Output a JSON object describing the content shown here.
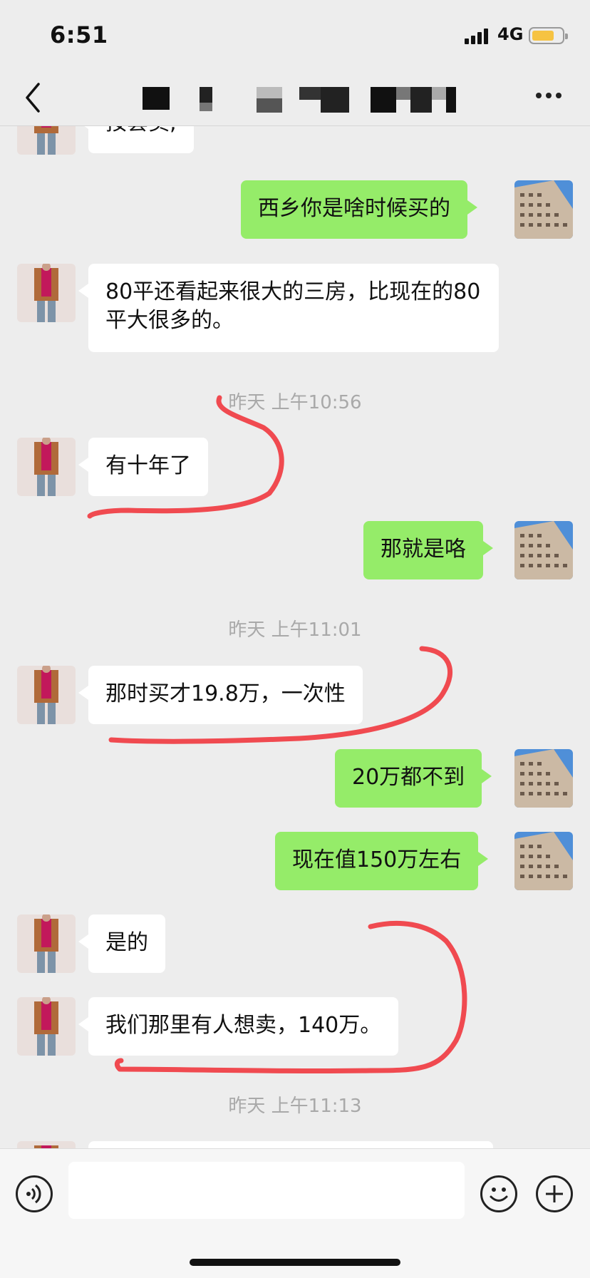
{
  "status_bar": {
    "time": "6:51",
    "network": "4G",
    "battery_level": 0.7,
    "battery_color": "#f6c342"
  },
  "nav": {
    "back_icon": "chevron-left-icon",
    "title": "",
    "title_obscured": true,
    "more_icon": "more-dots-icon"
  },
  "chat": {
    "messages": [
      {
        "side": "in",
        "text": "按套卖,"
      },
      {
        "side": "out",
        "text": "西乡你是啥时候买的"
      },
      {
        "side": "in",
        "text": "80平还看起来很大的三房，比现在的80平大很多的。"
      },
      {
        "side": "timestamp",
        "text": "昨天 上午10:56"
      },
      {
        "side": "in",
        "text": "有十年了"
      },
      {
        "side": "out",
        "text": "那就是咯"
      },
      {
        "side": "timestamp",
        "text": "昨天 上午11:01"
      },
      {
        "side": "in",
        "text": "那时买才19.8万，一次性"
      },
      {
        "side": "out",
        "text": "20万都不到"
      },
      {
        "side": "out",
        "text": "现在值150万左右"
      },
      {
        "side": "in",
        "text": "是的"
      },
      {
        "side": "in",
        "text": "我们那里有人想卖，140万。"
      },
      {
        "side": "timestamp",
        "text": "昨天 上午11:13"
      }
    ],
    "bubble_colors": {
      "in": "#ffffff",
      "out": "#95ec69"
    },
    "annotation_color": "#f04a50"
  },
  "input_bar": {
    "voice_icon": "voice-icon",
    "text_value": "",
    "emoji_icon": "emoji-icon",
    "plus_icon": "plus-icon"
  }
}
